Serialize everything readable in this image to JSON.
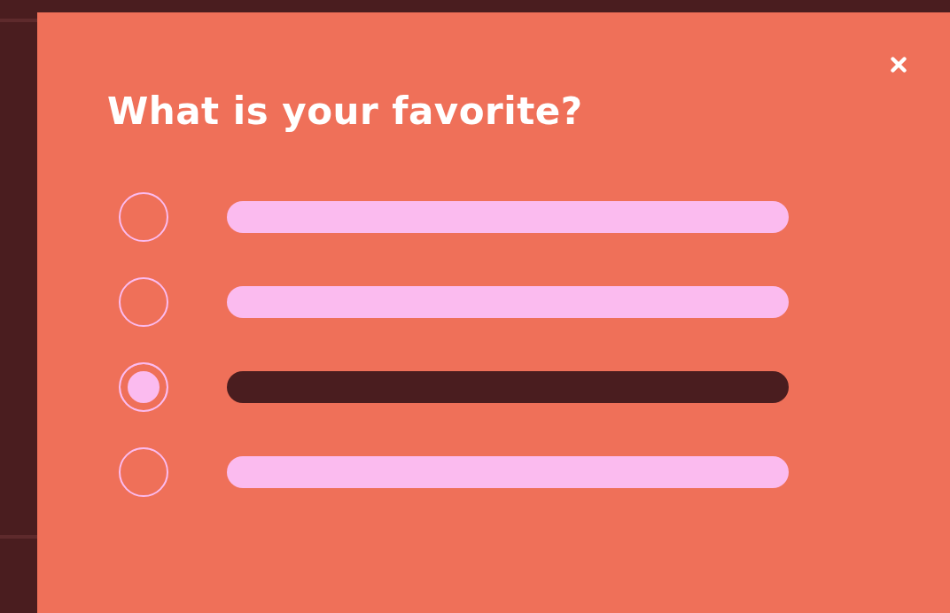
{
  "title": "What is your favorite?",
  "options": [
    {
      "selected": false
    },
    {
      "selected": false
    },
    {
      "selected": true
    },
    {
      "selected": false
    }
  ]
}
